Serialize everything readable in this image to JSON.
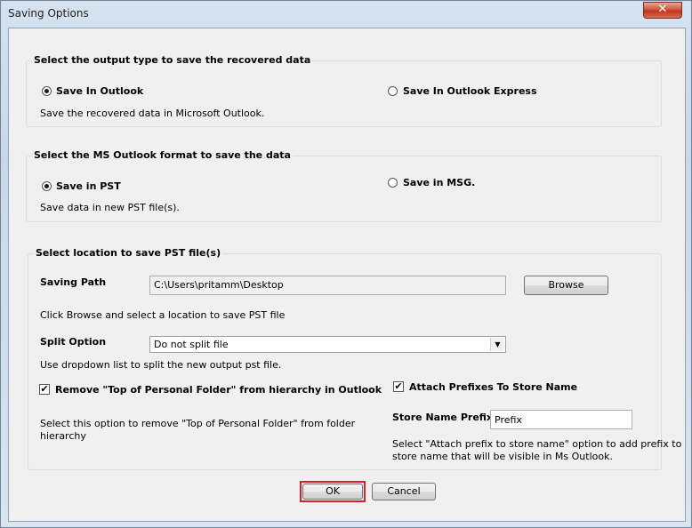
{
  "window": {
    "title": "Saving Options",
    "close_label": "✕"
  },
  "output_type": {
    "legend": "Select the output type to save the recovered data",
    "option_outlook": "Save In Outlook",
    "option_outlook_express": "Save In Outlook Express",
    "description": "Save the recovered data in Microsoft Outlook.",
    "selected": "Save In Outlook"
  },
  "format": {
    "legend": "Select the MS Outlook format to save the data",
    "option_pst": "Save in PST",
    "option_msg": "Save in MSG.",
    "description": "Save data in new PST file(s).",
    "selected": "Save in PST"
  },
  "location": {
    "legend": "Select location to save PST file(s)",
    "saving_path_label": "Saving Path",
    "saving_path_value": "C:\\Users\\pritamm\\Desktop",
    "browse_label": "Browse",
    "browse_hint": "Click Browse and select a location to save PST file",
    "split_label": "Split Option",
    "split_value": "Do not split file",
    "split_hint": "Use dropdown list to split the new output pst file.",
    "remove_top_label": "Remove \"Top of Personal Folder\" from hierarchy in Outlook",
    "remove_top_checked": true,
    "remove_top_hint_1": "Select this option to remove \"Top of Personal Folder\" from folder",
    "remove_top_hint_2": "hierarchy",
    "attach_prefix_label": "Attach Prefixes To Store Name",
    "attach_prefix_checked": true,
    "store_prefix_label": "Store Name Prefix",
    "store_prefix_value": "Prefix",
    "store_prefix_hint_1": "Select \"Attach prefix to store name\" option to add prefix to",
    "store_prefix_hint_2": "store name that will be visible in Ms Outlook."
  },
  "buttons": {
    "ok_label": "OK",
    "cancel_label": "Cancel"
  },
  "icons": {
    "check": "✔",
    "dropdown": "▼"
  }
}
